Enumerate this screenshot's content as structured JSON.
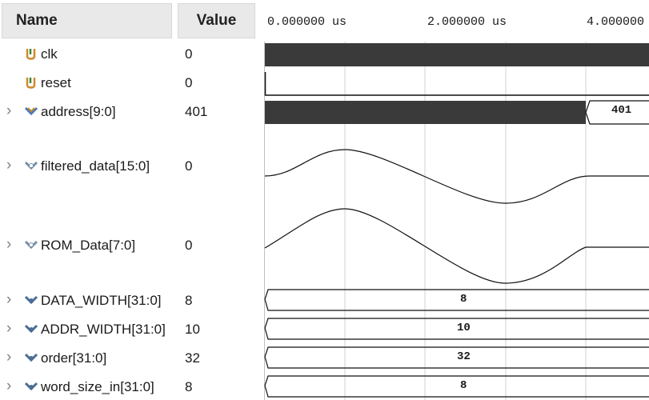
{
  "header": {
    "name_label": "Name",
    "value_label": "Value"
  },
  "time_axis": {
    "ticks": [
      "0.000000 us",
      "2.000000 us",
      "4.000000"
    ]
  },
  "signals": [
    {
      "name": "clk",
      "value": "0",
      "expandable": false,
      "icon": "bit-signal-icon"
    },
    {
      "name": "reset",
      "value": "0",
      "expandable": false,
      "icon": "bit-signal-icon"
    },
    {
      "name": "address[9:0]",
      "value": "401",
      "expandable": true,
      "icon": "bus-signal-icon"
    },
    {
      "name": "filtered_data[15:0]",
      "value": "0",
      "expandable": true,
      "icon": "analog-bus-icon"
    },
    {
      "name": "ROM_Data[7:0]",
      "value": "0",
      "expandable": true,
      "icon": "analog-bus-icon"
    },
    {
      "name": "DATA_WIDTH[31:0]",
      "value": "8",
      "expandable": true,
      "icon": "parameter-icon"
    },
    {
      "name": "ADDR_WIDTH[31:0]",
      "value": "10",
      "expandable": true,
      "icon": "parameter-icon"
    },
    {
      "name": "order[31:0]",
      "value": "32",
      "expandable": true,
      "icon": "parameter-icon"
    },
    {
      "name": "word_size_in[31:0]",
      "value": "8",
      "expandable": true,
      "icon": "parameter-icon"
    }
  ],
  "waveforms": {
    "address_bus_label": "401",
    "DATA_WIDTH_label": "8",
    "ADDR_WIDTH_label": "10",
    "order_label": "32",
    "word_size_in_label": "8"
  },
  "colors": {
    "header_bg": "#e9e9e9",
    "dense_bus": "#3a3a3a",
    "grid": "#d0d0d0",
    "wave": "#111111",
    "icon_green": "#3c8a3c",
    "icon_orange": "#d08a2a"
  }
}
